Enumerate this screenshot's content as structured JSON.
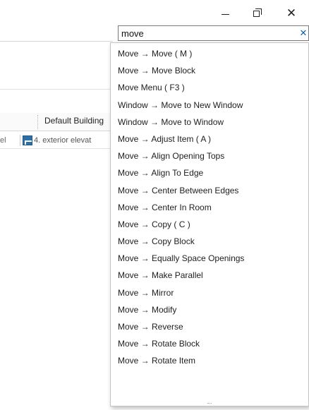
{
  "window": {
    "minimize_icon": "minimize-icon",
    "restore_icon": "restore-icon",
    "close_icon": "close-icon",
    "close_glyph": "✕"
  },
  "search": {
    "value": "move",
    "clear_glyph": "✕"
  },
  "background": {
    "toolbar_label": "Default Building",
    "tab_left_label": "el",
    "tab_label": "4. exterior elevat"
  },
  "dropdown": {
    "items": [
      "Move → Move ( M )",
      "Move → Move Block",
      "Move Menu ( F3 )",
      "Window → Move to New Window",
      "Window → Move to Window",
      "Move → Adjust Item ( A )",
      "Move → Align Opening Tops",
      "Move → Align To Edge",
      "Move → Center Between Edges",
      "Move → Center In Room",
      "Move → Copy ( C )",
      "Move → Copy Block",
      "Move → Equally Space Openings",
      "Move → Make Parallel",
      "Move → Mirror",
      "Move → Modify",
      "Move → Reverse",
      "Move → Rotate Block",
      "Move → Rotate Item"
    ]
  }
}
